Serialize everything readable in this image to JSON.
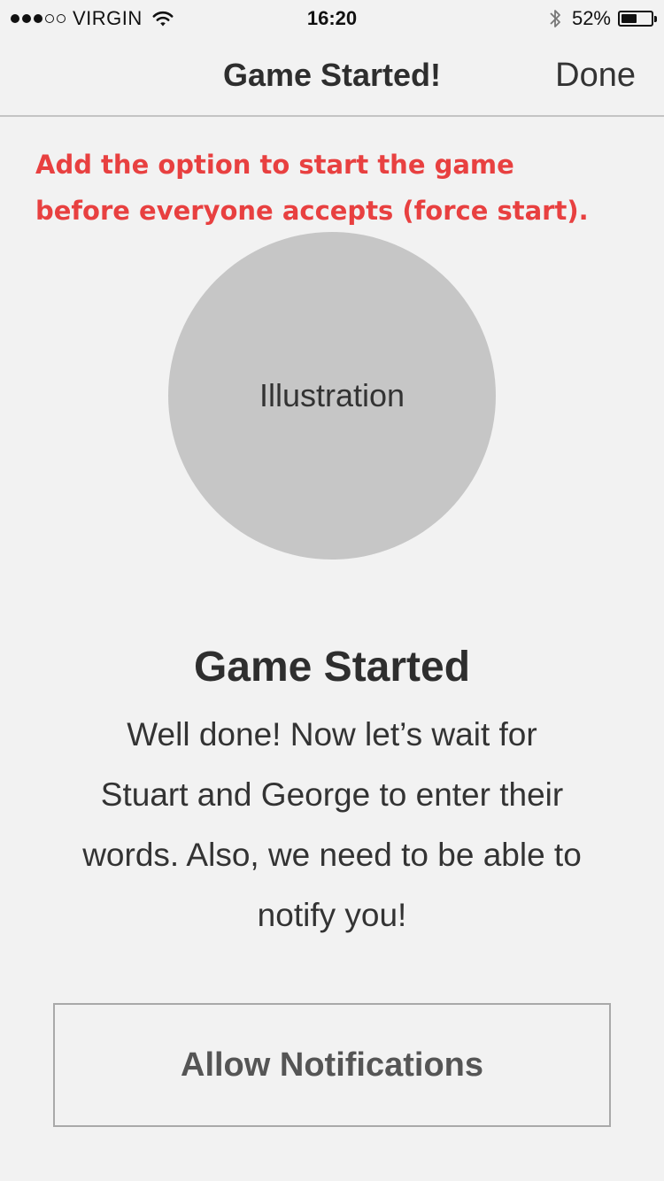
{
  "status_bar": {
    "signal_full": 3,
    "signal_empty": 2,
    "carrier": "VIRGIN",
    "time": "16:20",
    "battery_percent": "52%",
    "battery_level": 0.52
  },
  "nav": {
    "title": "Game Started!",
    "done_label": "Done"
  },
  "annotation": {
    "text": "Add the option to start the game before everyone accepts (force start)."
  },
  "illustration": {
    "label": "Illustration"
  },
  "content": {
    "heading": "Game Started",
    "body": "Well done! Now let’s wait for Stuart and George to enter their words. Also, we need to be able to notify you!"
  },
  "actions": {
    "allow_notifications_label": "Allow Notifications"
  },
  "colors": {
    "background": "#f2f2f2",
    "annotation": "#e84040",
    "illustration": "#c6c6c6",
    "button_border": "#a9a9a9"
  }
}
